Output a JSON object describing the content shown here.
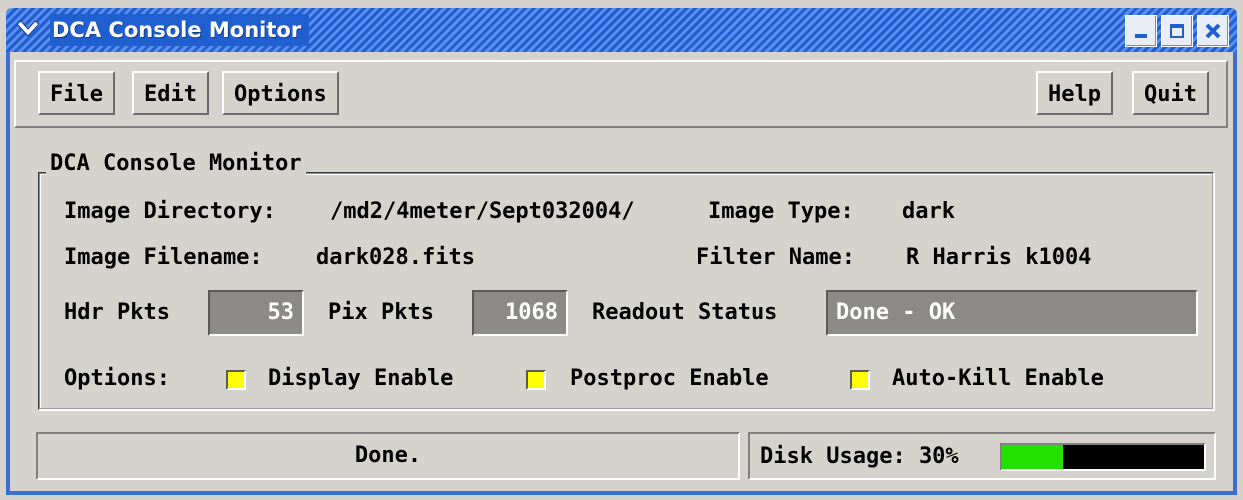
{
  "window": {
    "title": "DCA Console Monitor",
    "accent_color": "#1f5fd0",
    "title_icons": [
      "chevron-down-icon",
      "minimize-icon",
      "maximize-icon",
      "close-icon"
    ]
  },
  "menubar": {
    "file_label": "File",
    "edit_label": "Edit",
    "options_label": "Options",
    "help_label": "Help",
    "quit_label": "Quit"
  },
  "group": {
    "title": "DCA Console Monitor",
    "image_directory_label": "Image Directory:",
    "image_directory_value": "/md2/4meter/Sept032004/",
    "image_type_label": "Image Type:",
    "image_type_value": "dark",
    "image_filename_label": "Image Filename:",
    "image_filename_value": "dark028.fits",
    "filter_name_label": "Filter Name:",
    "filter_name_value": "R Harris k1004",
    "hdr_pkts_label": "Hdr Pkts",
    "hdr_pkts_value": "53",
    "pix_pkts_label": "Pix Pkts",
    "pix_pkts_value": "1068",
    "readout_status_label": "Readout Status",
    "readout_status_value": "Done - OK",
    "options_label": "Options:",
    "options": [
      {
        "label": "Display Enable",
        "checked": true
      },
      {
        "label": "Postproc Enable",
        "checked": true
      },
      {
        "label": "Auto-Kill Enable",
        "checked": true
      }
    ],
    "checkbox_color": "#ffff00"
  },
  "status": {
    "message": "Done.",
    "disk_usage_label": "Disk Usage: 30%",
    "disk_usage_fraction": 0.3,
    "disk_bar_color": "#22e000"
  }
}
